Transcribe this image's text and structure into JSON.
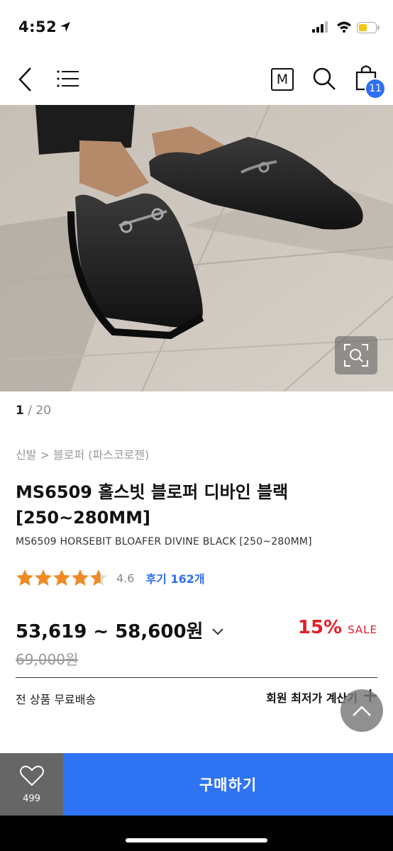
{
  "status_bar": {
    "time": "4:52"
  },
  "header": {
    "brand_mark": "M",
    "cart_count": "11",
    "icons": [
      "back-icon",
      "menu-icon",
      "brand-m-icon",
      "search-icon",
      "bag-icon"
    ]
  },
  "gallery": {
    "current": "1",
    "separator": " / ",
    "total": "20"
  },
  "breadcrumb": "신발 > 블로퍼 (파스코로젠)",
  "product": {
    "title": "MS6509 홀스빗 블로퍼 디바인 블랙 [250~280MM]",
    "subtitle": "MS6509 HORSEBIT BLOAFER DIVINE BLACK [250~280MM]",
    "rating": 4.6,
    "rating_text": "4.6",
    "reviews_label": "후기 162개",
    "price_range": "53,619 ~ 58,600원",
    "discount_pct": "15%",
    "sale_label": "SALE",
    "original_price": "69,000원"
  },
  "shipping": {
    "label": "전 상품 무료배송",
    "calc_label": "회원 최저가 계산기"
  },
  "bottom_bar": {
    "wish_count": "499",
    "buy_label": "구매하기"
  },
  "colors": {
    "accent_blue": "#2f74f2",
    "sale_red": "#e0202a",
    "star_orange": "#f08a24"
  }
}
